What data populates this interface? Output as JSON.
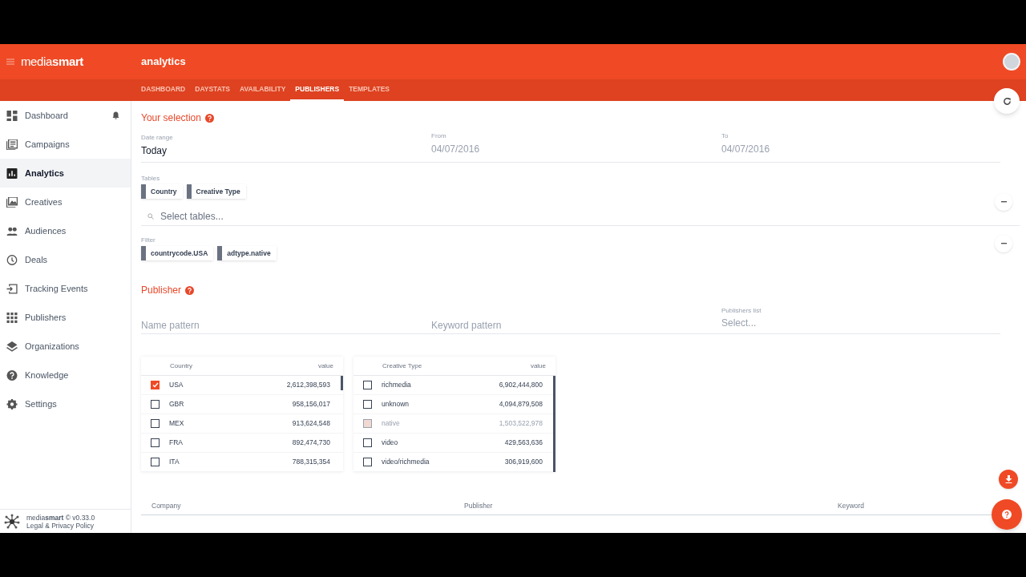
{
  "app": {
    "logo": "media**smart**",
    "title": "analytics"
  },
  "tabs": [
    {
      "label": "DASHBOARD",
      "selected": false
    },
    {
      "label": "DAYSTATS",
      "selected": false
    },
    {
      "label": "AVAILABILITY",
      "selected": false
    },
    {
      "label": "PUBLISHERS",
      "selected": true
    },
    {
      "label": "TEMPLATES",
      "selected": false
    }
  ],
  "sidebar": {
    "items": [
      {
        "label": "Dashboard",
        "selected": false,
        "notification": true
      },
      {
        "label": "Campaigns",
        "selected": false,
        "notification": false
      },
      {
        "label": "Analytics",
        "selected": true,
        "notification": false
      },
      {
        "label": "Creatives",
        "selected": false,
        "notification": false
      },
      {
        "label": "Audiences",
        "selected": false,
        "notification": false
      },
      {
        "label": "Deals",
        "selected": false,
        "notification": false
      },
      {
        "label": "Tracking Events",
        "selected": false,
        "notification": false
      },
      {
        "label": "Publishers",
        "selected": false,
        "notification": false
      },
      {
        "label": "Organizations",
        "selected": false,
        "notification": false
      },
      {
        "label": "Knowledge",
        "selected": false,
        "notification": false
      },
      {
        "label": "Settings",
        "selected": false,
        "notification": false
      }
    ],
    "footer": {
      "version": "media**smart** © v0.33.0",
      "link": "Legal & Privacy Policy"
    }
  },
  "selection": {
    "title": "Your selection",
    "date_range": {
      "label": "Date range",
      "value": "Today"
    },
    "from": {
      "label": "From",
      "value": "04/07/2016"
    },
    "to": {
      "label": "To",
      "value": "04/07/2016"
    },
    "tables": {
      "label": "Tables",
      "chips": [
        "Country",
        "Creative Type"
      ],
      "placeholder": "Select tables..."
    },
    "filter": {
      "label": "Filter",
      "chips": [
        "countrycode.USA",
        "adtype.native"
      ]
    }
  },
  "publisher": {
    "title": "Publisher",
    "name_pattern": {
      "placeholder": "Name pattern"
    },
    "keyword_pattern": {
      "placeholder": "Keyword pattern"
    },
    "publishers_list": {
      "label": "Publishers list",
      "placeholder": "Select..."
    }
  },
  "breakdowns": [
    {
      "columns": [
        "Country",
        "value"
      ],
      "rows": [
        {
          "label": "USA",
          "value": "2,612,398,593",
          "checked": true,
          "disabled": false
        },
        {
          "label": "GBR",
          "value": "958,156,017",
          "checked": false,
          "disabled": false
        },
        {
          "label": "MEX",
          "value": "913,624,548",
          "checked": false,
          "disabled": false
        },
        {
          "label": "FRA",
          "value": "892,474,730",
          "checked": false,
          "disabled": false
        },
        {
          "label": "ITA",
          "value": "788,315,354",
          "checked": false,
          "disabled": false
        }
      ]
    },
    {
      "columns": [
        "Creative Type",
        "value"
      ],
      "rows": [
        {
          "label": "richmedia",
          "value": "6,902,444,800",
          "checked": false,
          "disabled": false
        },
        {
          "label": "unknown",
          "value": "4,094,879,508",
          "checked": false,
          "disabled": false
        },
        {
          "label": "native",
          "value": "1,503,522,978",
          "checked": false,
          "disabled": true
        },
        {
          "label": "video",
          "value": "429,563,636",
          "checked": false,
          "disabled": false
        },
        {
          "label": "video/richmedia",
          "value": "306,919,600",
          "checked": false,
          "disabled": false
        }
      ]
    }
  ],
  "results": {
    "columns": [
      "Company",
      "Publisher",
      "Keyword"
    ]
  }
}
